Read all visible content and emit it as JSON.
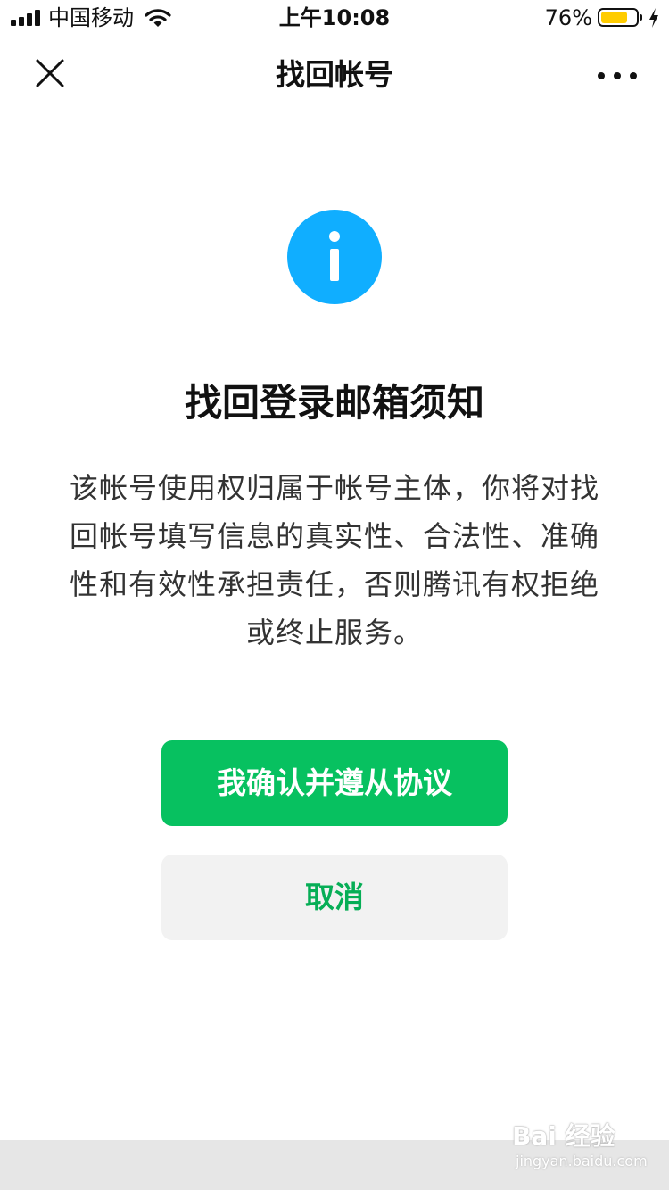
{
  "status_bar": {
    "carrier": "中国移动",
    "time": "上午10:08",
    "battery_percent": "76%",
    "battery_level": 0.76,
    "battery_color": "#ffcc00"
  },
  "nav": {
    "title": "找回帐号",
    "close_icon": "close-icon",
    "more_icon": "more-dots-icon"
  },
  "main": {
    "icon": "info-icon",
    "icon_color": "#10aeff",
    "heading": "找回登录邮箱须知",
    "notice": "该帐号使用权归属于帐号主体，你将对找回帐号填写信息的真实性、合法性、准确性和有效性承担责任，否则腾讯有权拒绝或终止服务。"
  },
  "actions": {
    "confirm_label": "我确认并遵从协议",
    "cancel_label": "取消",
    "primary_color": "#07c160"
  },
  "watermark": {
    "main": "Bai 经验",
    "sub": "jingyan.baidu.com"
  }
}
